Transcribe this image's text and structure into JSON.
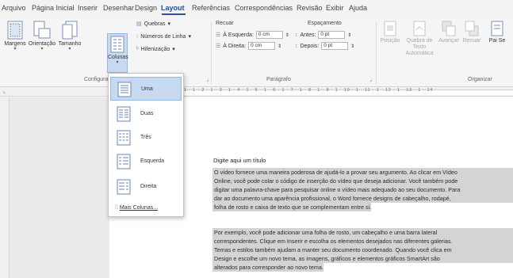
{
  "tabs": [
    {
      "label": "Arquivo"
    },
    {
      "label": "Página Inicial"
    },
    {
      "label": "Inserir"
    },
    {
      "label": "Desenhar"
    },
    {
      "label": "Design"
    },
    {
      "label": "Layout"
    },
    {
      "label": "Referências"
    },
    {
      "label": "Correspondências"
    },
    {
      "label": "Revisão"
    },
    {
      "label": "Exibir"
    },
    {
      "label": "Ajuda"
    }
  ],
  "active_tab": "Layout",
  "ribbon": {
    "margins_label": "Margens",
    "orientation_label": "Orientação",
    "size_label": "Tamanho",
    "columns_label": "Colunas",
    "breaks_label": "Quebras",
    "line_numbers_label": "Números de Linha",
    "hyphenation_label": "Hifenização",
    "group_config": "Configurar",
    "indent_title": "Recuar",
    "indent_left_label": "À Esquerda:",
    "indent_left_value": "0 cm",
    "indent_right_label": "À Direita:",
    "indent_right_value": "0 cm",
    "spacing_title": "Espaçamento",
    "spacing_before_label": "Antes:",
    "spacing_before_value": "0 pt",
    "spacing_after_label": "Depois:",
    "spacing_after_value": "0 pt",
    "group_paragraph": "Parágrafo",
    "position_label": "Posição",
    "wrap_label": "Quebra de Texto Automática",
    "forward_label": "Avançar",
    "backward_label": "Recuar",
    "partial_label": "Pai Se",
    "group_arrange": "Organizar"
  },
  "columns_menu": {
    "items": [
      {
        "label": "Uma",
        "selected": true
      },
      {
        "label": "Duas",
        "selected": false
      },
      {
        "label": "Três",
        "selected": false
      },
      {
        "label": "Esquerda",
        "selected": false
      },
      {
        "label": "Direita",
        "selected": false
      }
    ],
    "more_label": "Mais Colunas..."
  },
  "ruler_numbers": "1 · 1 · 2 · 1 · 3 · 1 · 4 · 1 · 5 · 1 · 6 · 1 · 7 · 1 · 8 · 1 · 9 · 1 · 10 · 1 · 11 · 1 · 12 · 1 · 13 · 1 · 14 ·",
  "document": {
    "title": "Digite aqui um título",
    "paragraph1": [
      "O vídeo fornece uma maneira poderosa de ajudá-lo a provar seu argumento. Ao clicar em Vídeo",
      "Online, você pode colar o código de inserção do vídeo que deseja adicionar. Você também pode",
      "digitar uma palavra-chave para pesquisar online o vídeo mais adequado ao seu documento. Para",
      "dar ao documento uma aparência profissional, o Word fornece designs de cabeçalho, rodapé,",
      "folha de rosto e caixa de texto que se complementam entre si."
    ],
    "paragraph2": [
      "Por exemplo, você pode adicionar uma folha de rosto, um cabeçalho e uma barra lateral",
      "correspondentes. Clique em Inserir e escolha os elementos desejados nas diferentes galerias.",
      "Temas e estilos também ajudam a manter seu documento coordenado. Quando você clica em",
      "Design e escolhe um novo tema, as imagens, gráficos e elementos gráficos SmartArt são",
      "alterados para corresponder ao novo tema."
    ]
  },
  "colors": {
    "accent": "#2b579a",
    "selection": "#d4d4d4",
    "menu_highlight": "#c8daf2"
  }
}
